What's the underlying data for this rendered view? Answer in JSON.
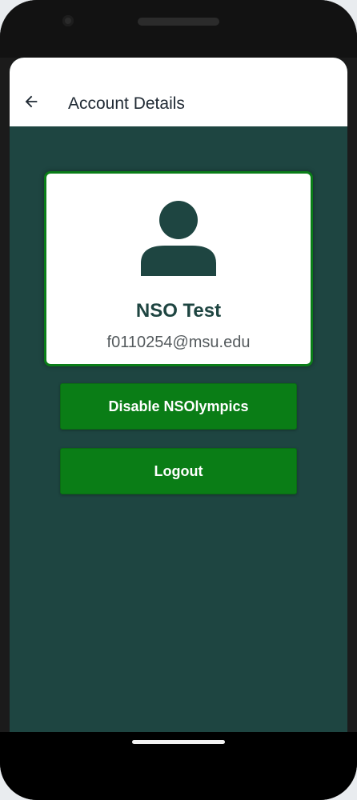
{
  "appbar": {
    "title": "Account Details",
    "back_icon": "arrow-left-icon"
  },
  "profile": {
    "avatar_icon": "person-icon",
    "name": "NSO Test",
    "email": "f0110254@msu.edu"
  },
  "actions": {
    "disable_label": "Disable NSOlympics",
    "logout_label": "Logout"
  },
  "colors": {
    "background": "#1e4541",
    "accent": "#0a7d16",
    "appbar": "#ffffff"
  }
}
